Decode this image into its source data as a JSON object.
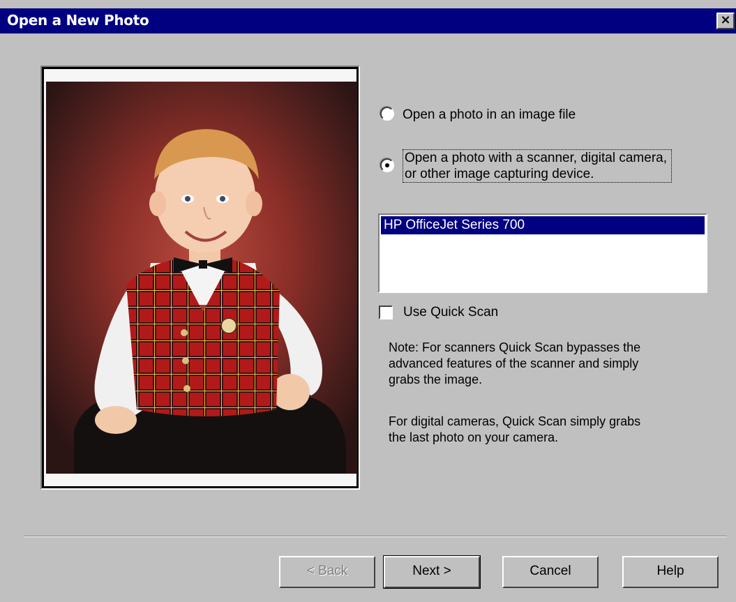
{
  "window": {
    "title": "Open a New Photo",
    "close_label": "×"
  },
  "options": {
    "open_file_label": "Open a photo in an image file",
    "open_device_line1": "Open a photo with a scanner, digital camera,",
    "open_device_line2": "or other image capturing device.",
    "selected": "device"
  },
  "device_list": {
    "items": [
      "HP OfficeJet Series 700"
    ],
    "selected": "HP OfficeJet Series 700"
  },
  "quick_scan": {
    "label": "Use Quick Scan",
    "checked": false
  },
  "notes": {
    "line1": "Note: For scanners Quick Scan bypasses the",
    "line2": "advanced features of the scanner and simply",
    "line3": "grabs the image.",
    "line4": "For digital cameras, Quick Scan simply grabs",
    "line5": "the last photo on your camera."
  },
  "buttons": {
    "back": "< Back",
    "next": "Next >",
    "cancel": "Cancel",
    "help": "Help"
  },
  "colors": {
    "titlebar": "#000080",
    "face": "#c0c0c0",
    "selection": "#000080"
  }
}
